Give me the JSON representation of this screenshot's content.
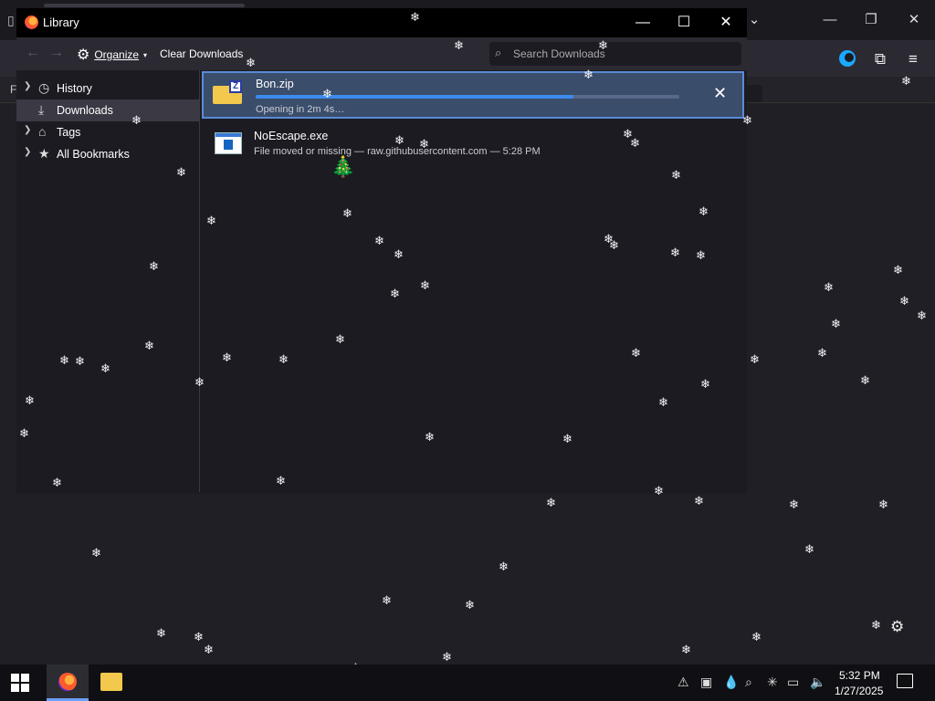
{
  "library": {
    "title": "Library",
    "controls": {
      "minimize": "—",
      "maximize": "☐",
      "close": "✕"
    },
    "toolbar": {
      "organize": "Organize",
      "clear_downloads": "Clear Downloads",
      "search_placeholder": "Search Downloads"
    },
    "sidebar": [
      {
        "label": "History",
        "icon": "clock-icon",
        "selected": false
      },
      {
        "label": "Downloads",
        "icon": "download-icon",
        "selected": true
      },
      {
        "label": "Tags",
        "icon": "tag-icon",
        "selected": false
      },
      {
        "label": "All Bookmarks",
        "icon": "star-icon",
        "selected": false
      }
    ],
    "downloads": [
      {
        "name": "Bon.zip",
        "status": "Opening in 2m 4s…",
        "progress": 0.75,
        "icon": "zip-file-icon"
      },
      {
        "name": "NoEscape.exe",
        "status": "File moved or missing — raw.githubusercontent.com — 5:28 PM",
        "icon": "exe-file-icon"
      }
    ]
  },
  "background": {
    "letter": "F"
  },
  "taskbar": {
    "clock_time": "5:32 PM",
    "clock_date": "1/27/2025"
  }
}
